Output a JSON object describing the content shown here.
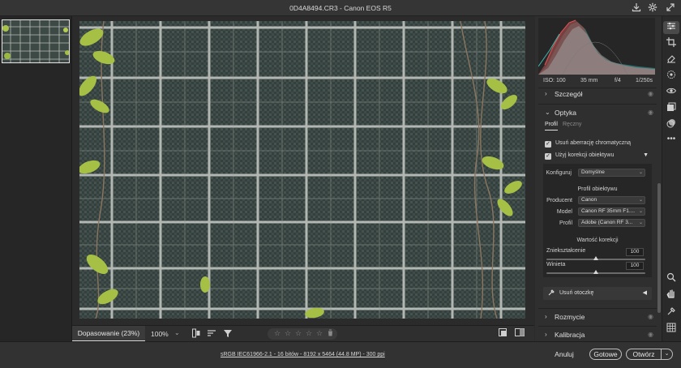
{
  "window": {
    "title": "0D4A8494.CR3  -  Canon EOS R5"
  },
  "titlebar_icons": [
    "download-icon",
    "gear-icon",
    "expand-icon"
  ],
  "canvas": {
    "fit_label": "Dopasowanie (23%)",
    "zoom_value": "100%",
    "rating_stars": 5
  },
  "exif": {
    "iso": "ISO: 100",
    "focal": "35 mm",
    "aperture": "f/4",
    "shutter": "1/250s"
  },
  "panel": {
    "detail_section": "Szczegół",
    "optics_section": "Optyka",
    "tab_profile": "Profil",
    "tab_manual": "Ręczny",
    "remove_ca": "Usuń aberrację chromatyczną",
    "use_lens_profile": "Użyj korekcji obiektywu",
    "setup_label": "Konfiguruj",
    "setup_value": "Domyślne",
    "lens_profile_heading": "Profil obiektywu",
    "maker_label": "Producent",
    "maker_value": "Canon",
    "model_label": "Model",
    "model_value": "Canon RF 35mm F1....",
    "profile_label": "Profil",
    "profile_value": "Adobe (Canon RF 3...",
    "correction_heading": "Wartość korekcji",
    "distortion_label": "Zniekształcenie",
    "distortion_value": "100",
    "vignette_label": "Winieta",
    "vignette_value": "100",
    "defringe_label": "Usuń otoczkę",
    "blur_section": "Rozmycie",
    "calibration_section": "Kalibracja"
  },
  "footer": {
    "meta_link": "sRGB IEC61966-2.1 - 16 bitów - 8192 x 5464 (44.8 MP) - 300 ppi",
    "cancel": "Anuluj",
    "done": "Gotowe",
    "open": "Otwórz"
  }
}
